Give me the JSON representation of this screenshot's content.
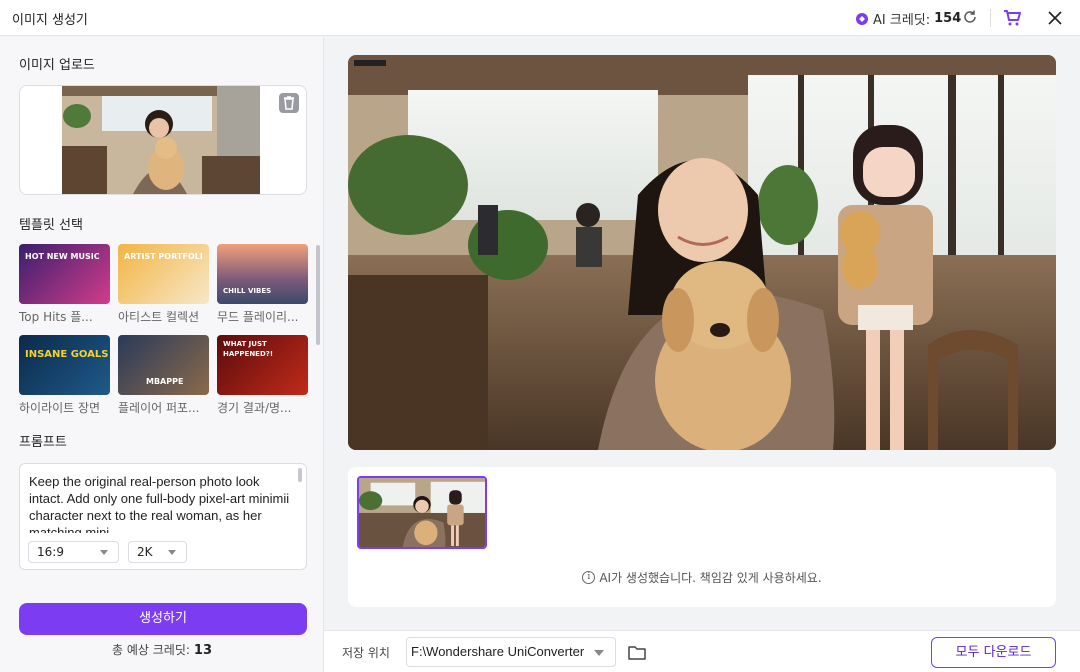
{
  "window": {
    "title": "이미지 생성기"
  },
  "header": {
    "credit_label": "AI 크레딧:",
    "credit_count": "154"
  },
  "upload": {
    "title": "이미지 업로드"
  },
  "templates": {
    "title": "템플릿 선택",
    "items": [
      {
        "label": "Top Hits 플...",
        "thumb_text": "HOT NEW MUSIC"
      },
      {
        "label": "아티스트 컬렉션",
        "thumb_text": "ARTIST PORTFOLI"
      },
      {
        "label": "무드 플레이리...",
        "thumb_text": "CHILL VIBES"
      },
      {
        "label": "하이라이트 장면",
        "thumb_text": "INSANE GOALS"
      },
      {
        "label": "플레이어 퍼포...",
        "thumb_text": "MBAPPE"
      },
      {
        "label": "경기 결과/명...",
        "thumb_text": "WHAT JUST HAPPENED?!"
      }
    ]
  },
  "prompt": {
    "title": "프롬프트",
    "text": "Keep the original real-person photo look intact. Add only one full-body pixel-art minimii character next to the real woman, as her matching mini",
    "ratio": "16:9",
    "resolution": "2K"
  },
  "actions": {
    "generate_label": "생성하기",
    "total_label": "총 예상 크레딧:",
    "total_value": "13"
  },
  "result": {
    "notice": "AI가 생성했습니다. 책임감 있게 사용하세요."
  },
  "footer": {
    "save_label": "저장 위치",
    "path": "F:\\Wondershare UniConverter",
    "download_label": "모두 다운로드"
  },
  "colors": {
    "accent": "#7c3cf2"
  }
}
